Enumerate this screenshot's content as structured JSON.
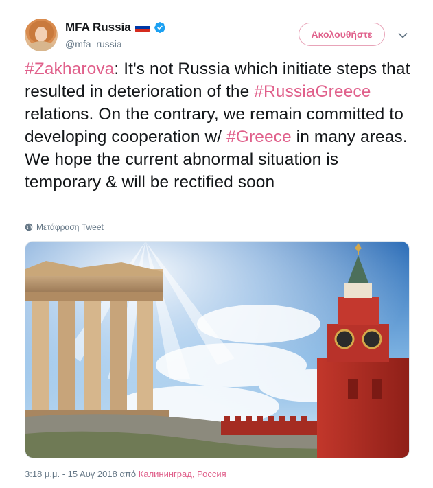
{
  "author": {
    "display_name": "MFA Russia",
    "handle": "@mfa_russia",
    "verified_icon": "verified-badge-icon",
    "flag_icon": "russian-flag-icon"
  },
  "actions": {
    "follow_label": "Ακολουθήστε",
    "menu_icon": "chevron-down-icon"
  },
  "tweet": {
    "segments": [
      {
        "text": "#Zakharova",
        "hashtag": true
      },
      {
        "text": ": It's not Russia which initiate steps that resulted in deterioration of the ",
        "hashtag": false
      },
      {
        "text": "#RussiaGreece",
        "hashtag": true
      },
      {
        "text": " relations. On the contrary, we remain committed to developing cooperation w/ ",
        "hashtag": false
      },
      {
        "text": "#Greece",
        "hashtag": true
      },
      {
        "text": " in many areas. We hope the current abnormal situation is temporary & will be rectified soon",
        "hashtag": false
      }
    ]
  },
  "translate": {
    "label": "Μετάφραση Tweet",
    "icon": "globe-icon"
  },
  "footer": {
    "time": "3:18 μ.μ. - 15 Αυγ 2018 από ",
    "location": "Калининград, Россия"
  },
  "colors": {
    "accent": "#e0608b",
    "text": "#14171a",
    "muted": "#657786",
    "verified": "#1da1f2"
  }
}
